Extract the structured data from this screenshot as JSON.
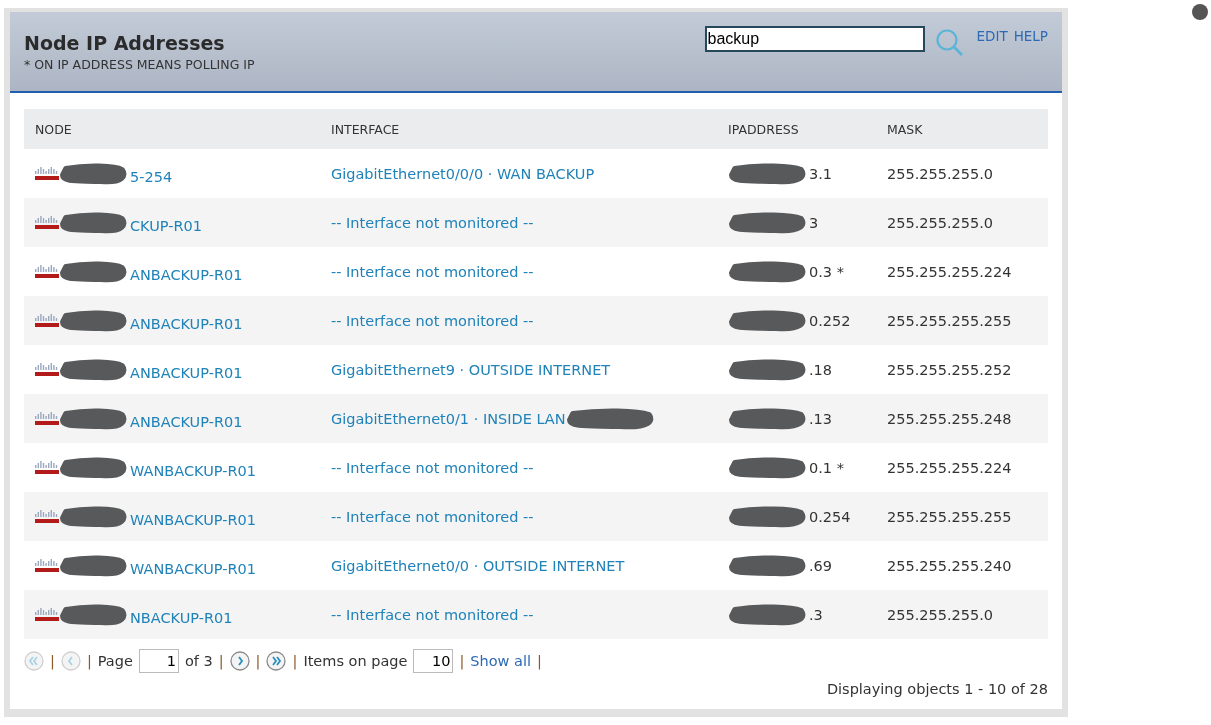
{
  "panel": {
    "title": "Node IP Addresses",
    "subtitle": "* ON IP ADDRESS MEANS POLLING IP",
    "search": {
      "value": "backup"
    },
    "links": [
      "EDIT",
      "HELP"
    ]
  },
  "table": {
    "columns": [
      "NODE",
      "INTERFACE",
      "IPADDRESS",
      "MASK"
    ],
    "rows": [
      {
        "node": "5-254",
        "interface": "GigabitEthernet0/0/0 · WAN BACKUP",
        "interface_redacted": false,
        "ipaddress": "3.1",
        "mask": "255.255.255.0"
      },
      {
        "node": "CKUP-R01",
        "interface": "-- Interface not monitored --",
        "interface_redacted": false,
        "ipaddress": "3",
        "mask": "255.255.255.0"
      },
      {
        "node": "ANBACKUP-R01",
        "interface": "-- Interface not monitored --",
        "interface_redacted": false,
        "ipaddress": "0.3 *",
        "mask": "255.255.255.224"
      },
      {
        "node": "ANBACKUP-R01",
        "interface": "-- Interface not monitored --",
        "interface_redacted": false,
        "ipaddress": "0.252",
        "mask": "255.255.255.255"
      },
      {
        "node": "ANBACKUP-R01",
        "interface": "GigabitEthernet9 · OUTSIDE INTERNET",
        "interface_redacted": false,
        "ipaddress": ".18",
        "mask": "255.255.255.252"
      },
      {
        "node": "ANBACKUP-R01",
        "interface": "GigabitEthernet0/1 · INSIDE LAN",
        "interface_redacted": true,
        "ipaddress": ".13",
        "mask": "255.255.255.248"
      },
      {
        "node": "WANBACKUP-R01",
        "interface": "-- Interface not monitored --",
        "interface_redacted": false,
        "ipaddress": "0.1 *",
        "mask": "255.255.255.224"
      },
      {
        "node": "WANBACKUP-R01",
        "interface": "-- Interface not monitored --",
        "interface_redacted": false,
        "ipaddress": "0.254",
        "mask": "255.255.255.255"
      },
      {
        "node": "WANBACKUP-R01",
        "interface": "GigabitEthernet0/0 · OUTSIDE INTERNET",
        "interface_redacted": false,
        "ipaddress": ".69",
        "mask": "255.255.255.240"
      },
      {
        "node": "NBACKUP-R01",
        "interface": "-- Interface not monitored --",
        "interface_redacted": false,
        "ipaddress": ".3",
        "mask": "255.255.255.0"
      }
    ]
  },
  "pager": {
    "items": [
      {
        "kind": "first",
        "disabled": true
      },
      {
        "kind": "sep",
        "text": "|"
      },
      {
        "kind": "prev",
        "disabled": true
      },
      {
        "kind": "sep",
        "text": "|"
      },
      {
        "kind": "label",
        "text": "Page"
      },
      {
        "kind": "field",
        "value": "1"
      },
      {
        "kind": "label",
        "text": "of 3"
      },
      {
        "kind": "sep",
        "text": "|"
      },
      {
        "kind": "next",
        "disabled": false
      },
      {
        "kind": "sep",
        "text": "|"
      },
      {
        "kind": "last",
        "disabled": false
      },
      {
        "kind": "sep",
        "text": "|"
      },
      {
        "kind": "label",
        "text": "Items on page"
      },
      {
        "kind": "field",
        "value": "10"
      },
      {
        "kind": "sep",
        "text": "|"
      },
      {
        "kind": "link",
        "text": "Show all"
      },
      {
        "kind": "sep",
        "text": "|"
      }
    ],
    "status": "Displaying objects 1 - 10 of 28"
  }
}
